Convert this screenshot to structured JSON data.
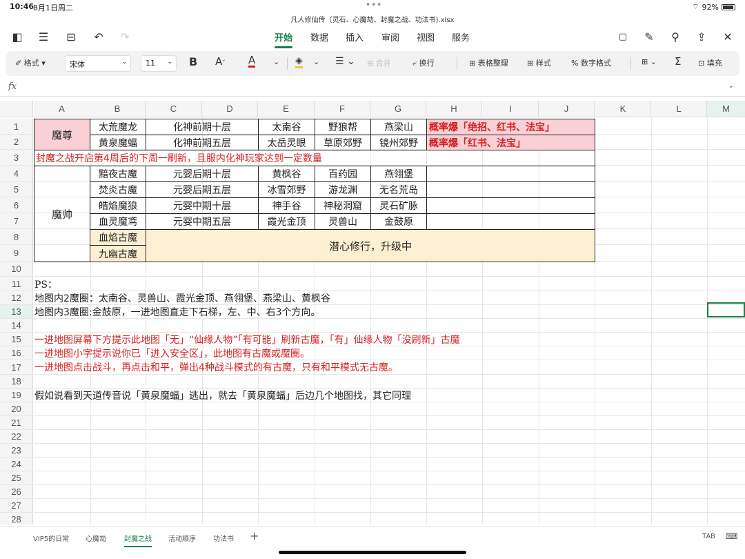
{
  "status": {
    "time": "10:46",
    "date": "8月1日周二",
    "battery": "92%"
  },
  "file": {
    "name": "凡人修仙传（灵石、心魔劫、封魔之战、功法书).xlsx"
  },
  "menu": {
    "items": [
      "开始",
      "数据",
      "插入",
      "审阅",
      "视图",
      "服务"
    ],
    "active": 0
  },
  "toolbar": {
    "format": "格式",
    "font": "宋体",
    "size": "11",
    "merge": "合并",
    "wrap": "换行",
    "table_tidy": "表格整理",
    "style": "样式",
    "num_format": "数字格式",
    "fill": "填充"
  },
  "formula": {
    "label": "fx",
    "value": ""
  },
  "columns": [
    "A",
    "B",
    "C",
    "D",
    "E",
    "F",
    "G",
    "H",
    "I",
    "J",
    "K",
    "L",
    "M"
  ],
  "rows": [
    "1",
    "2",
    "3",
    "4",
    "5",
    "6",
    "7",
    "8",
    "9",
    "10",
    "11",
    "12",
    "13",
    "14",
    "15",
    "16",
    "17",
    "18",
    "19",
    "20",
    "21",
    "22",
    "23",
    "24",
    "25",
    "26",
    "27",
    "28"
  ],
  "table": {
    "mozun": "魔尊",
    "moshuai": "魔帅",
    "r1": [
      "太荒魔龙",
      "化神前期十层",
      "太南谷",
      "野狼帮",
      "燕梁山",
      "概率爆「绝招、红书、法宝」"
    ],
    "r2": [
      "黄泉魔蝠",
      "化神前期五层",
      "太岳灵眼",
      "草原郊野",
      "镜州郊野",
      "概率爆「红书、法宝」"
    ],
    "r3": "封魔之战开启第4周后的下周一刷新，且服内化神玩家达到一定数量",
    "r4": [
      "黯夜古魔",
      "元婴后期十层",
      "黄枫谷",
      "百药园",
      "燕翎堡"
    ],
    "r5": [
      "焚炎古魔",
      "元婴后期五层",
      "冰雪郊野",
      "游龙渊",
      "无名荒岛"
    ],
    "r6": [
      "皓焰魔狼",
      "元婴中期十层",
      "神手谷",
      "神秘洞窟",
      "灵石矿脉"
    ],
    "r7": [
      "血灵魔鸢",
      "元婴中期五层",
      "霞光金顶",
      "灵兽山",
      "金鼓原"
    ],
    "r8": "血焰古魔",
    "r9": "九幽古魔",
    "merged": "潜心修行，升级中"
  },
  "notes": {
    "r11": "PS：",
    "r12": "地图内2魔圈：太南谷、灵兽山、霞光金顶、燕翎堡、燕梁山、黄枫谷",
    "r13": "地图内3魔圈:金鼓原，一进地图直走下石梯，左、中、右3个方向。",
    "r15": "一进地图屏幕下方提示此地图「无」“仙缘人物”「有可能」刷新古魔，「有」仙缘人物「没刷新」古魔",
    "r16": "一进地图小字提示说你已「进入安全区」，此地图有古魔或魔圈。",
    "r17": "一进地图点击战斗，再点击和平，弹出4种战斗模式的有古魔，只有和平模式无古魔。",
    "r19": "假如说看到天道传音说「黄泉魔蝠」逃出，就去「黄泉魔蝠」后边几个地图找，其它同理"
  },
  "sheets": {
    "items": [
      "VIP5的日常",
      "心魔劫",
      "封魔之战",
      "活动顺序",
      "功法书"
    ],
    "active": 2,
    "tab_key": "TAB"
  },
  "colors": {
    "accent": "#1a7f4b",
    "pink": "#f8d0d6",
    "cream": "#fdf0d2",
    "red": "#d62020"
  }
}
